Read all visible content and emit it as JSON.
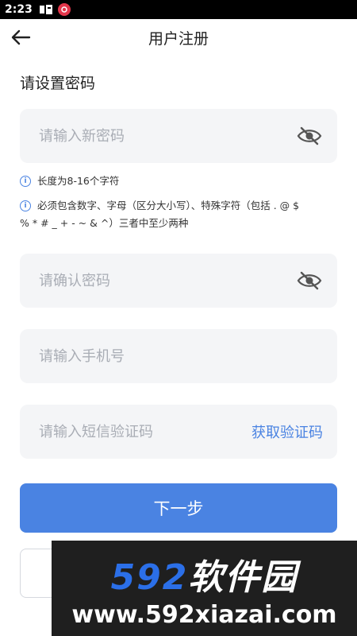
{
  "status_bar": {
    "time": "2:23",
    "app_icon": "app-icon",
    "notif_text": "ⓓ"
  },
  "navbar": {
    "title": "用户注册",
    "back_icon": "arrow-left-icon"
  },
  "form": {
    "section_title": "请设置密码",
    "new_password_placeholder": "请输入新密码",
    "hint_length": "长度为8-16个字符",
    "hint_rules_line1": "必须包含数字、字母（区分大小写）、特殊字符（包括 . @ $",
    "hint_rules_line2": "% * # _ + - ~ & ^）三者中至少两种",
    "confirm_password_placeholder": "请确认密码",
    "phone_placeholder": "请输入手机号",
    "sms_code_placeholder": "请输入短信验证码",
    "get_code_label": "获取验证码",
    "next_label": "下一步"
  },
  "watermark": {
    "logo_num": "592",
    "logo_cn": "软件园",
    "url": "www.592xiazai.com"
  },
  "colors": {
    "accent": "#4a83e2",
    "field_bg": "#f4f5f7",
    "placeholder": "#a9adb5"
  }
}
